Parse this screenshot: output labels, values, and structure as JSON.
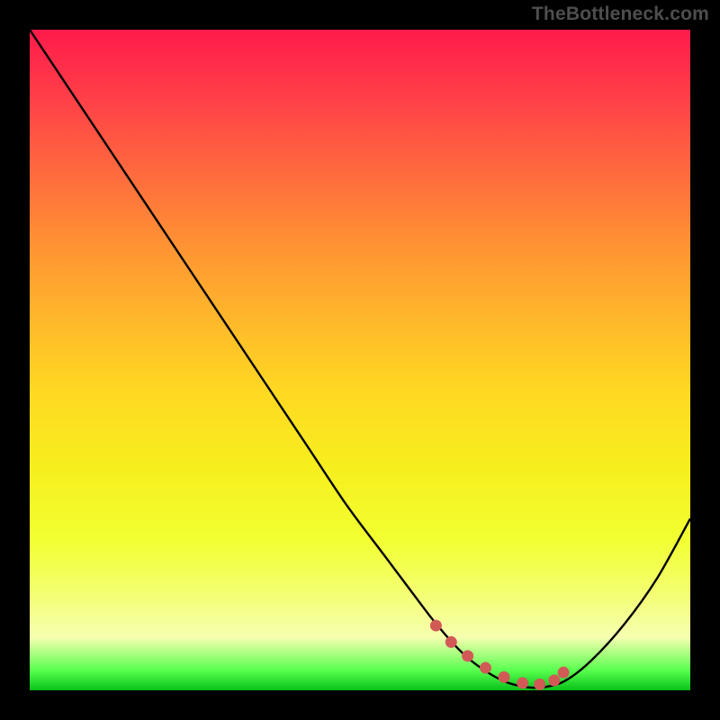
{
  "watermark": "TheBottleneck.com",
  "chart_data": {
    "type": "line",
    "title": "",
    "xlabel": "",
    "ylabel": "",
    "xlim": [
      0,
      100
    ],
    "ylim": [
      0,
      100
    ],
    "series": [
      {
        "name": "curve",
        "x": [
          0,
          6,
          12,
          18,
          24,
          30,
          36,
          42,
          48,
          54,
          60,
          62,
          64,
          66,
          68,
          70,
          72,
          74,
          76,
          78,
          81,
          85,
          90,
          95,
          100
        ],
        "values": [
          100,
          91,
          82,
          73,
          64,
          55,
          46,
          37,
          28,
          20,
          12,
          9.5,
          7.2,
          5.2,
          3.6,
          2.3,
          1.3,
          0.7,
          0.4,
          0.5,
          1.4,
          4.5,
          10,
          17,
          26
        ]
      }
    ],
    "markers": {
      "name": "bottom-dots",
      "color": "#d15a57",
      "x": [
        61.5,
        63.8,
        66.3,
        69.0,
        71.8,
        74.6,
        77.2,
        79.4,
        80.8
      ],
      "values": [
        9.8,
        7.3,
        5.2,
        3.4,
        2.0,
        1.1,
        0.9,
        1.5,
        2.7
      ]
    }
  },
  "colors": {
    "curve": "#000000",
    "dot": "#d15a57",
    "bg": "#000000"
  }
}
